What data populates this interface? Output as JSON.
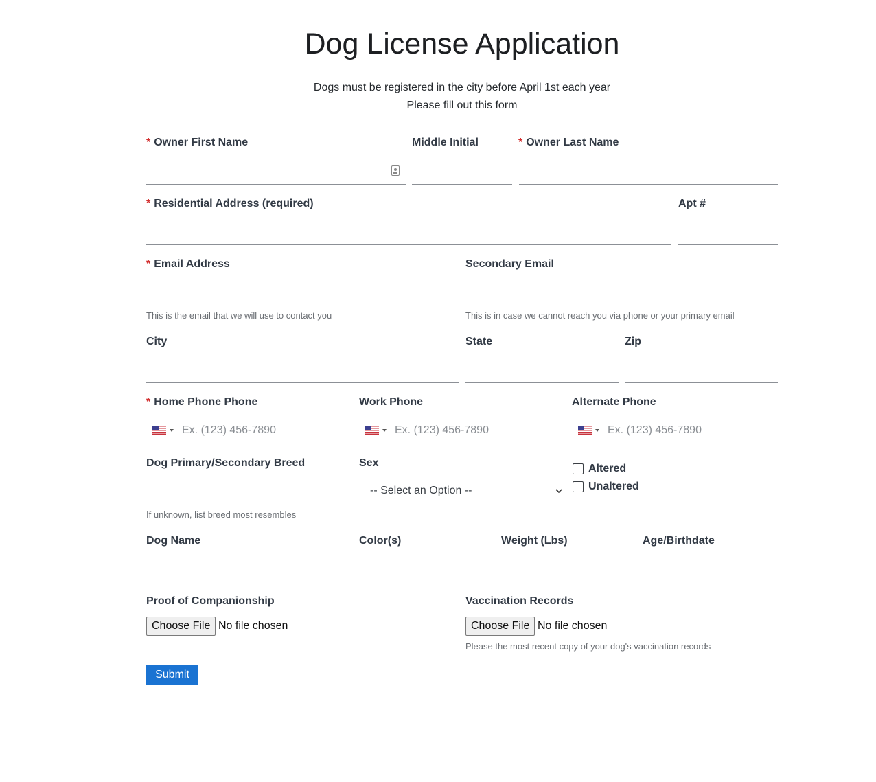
{
  "title": "Dog License Application",
  "subtitle_lines": [
    "Dogs must be registered in the city before April 1st each year",
    "Please fill out this form"
  ],
  "required_mark": "*",
  "fields": {
    "owner_first_name": {
      "label": "Owner First Name",
      "required": true
    },
    "middle_initial": {
      "label": "Middle Initial"
    },
    "owner_last_name": {
      "label": "Owner Last Name",
      "required": true
    },
    "residential_address": {
      "label": "Residential Address (required)",
      "required": true
    },
    "apt": {
      "label": "Apt #"
    },
    "email": {
      "label": "Email Address",
      "required": true,
      "help": "This is the email that we will use to contact you"
    },
    "secondary_email": {
      "label": "Secondary Email",
      "help": "This is in case we cannot reach you via phone or your primary email"
    },
    "city": {
      "label": "City"
    },
    "state": {
      "label": "State"
    },
    "zip": {
      "label": "Zip"
    },
    "home_phone": {
      "label": "Home Phone Phone",
      "required": true,
      "placeholder": "Ex. (123) 456-7890"
    },
    "work_phone": {
      "label": "Work Phone",
      "placeholder": "Ex. (123) 456-7890"
    },
    "alternate_phone": {
      "label": "Alternate Phone",
      "placeholder": "Ex. (123) 456-7890"
    },
    "breed": {
      "label": "Dog Primary/Secondary Breed",
      "help": "If unknown, list breed most resembles"
    },
    "sex": {
      "label": "Sex",
      "selected": "-- Select an Option --"
    },
    "altered": {
      "label": "Altered",
      "checked": false
    },
    "unaltered": {
      "label": "Unaltered",
      "checked": false
    },
    "dog_name": {
      "label": "Dog Name"
    },
    "colors": {
      "label": "Color(s)"
    },
    "weight": {
      "label": "Weight (Lbs)"
    },
    "age": {
      "label": "Age/Birthdate"
    },
    "proof": {
      "label": "Proof of Companionship",
      "button": "Choose File",
      "status": "No file chosen"
    },
    "vaccination": {
      "label": "Vaccination Records",
      "button": "Choose File",
      "status": "No file chosen",
      "help": "Please the most recent copy of your dog's vaccination records"
    }
  },
  "submit_label": "Submit",
  "colors": {
    "required": "#d32f2f",
    "submit": "#1a73d2"
  },
  "icons": {
    "phone_country": "us-flag-icon",
    "contact_autofill": "contact-card-icon"
  }
}
